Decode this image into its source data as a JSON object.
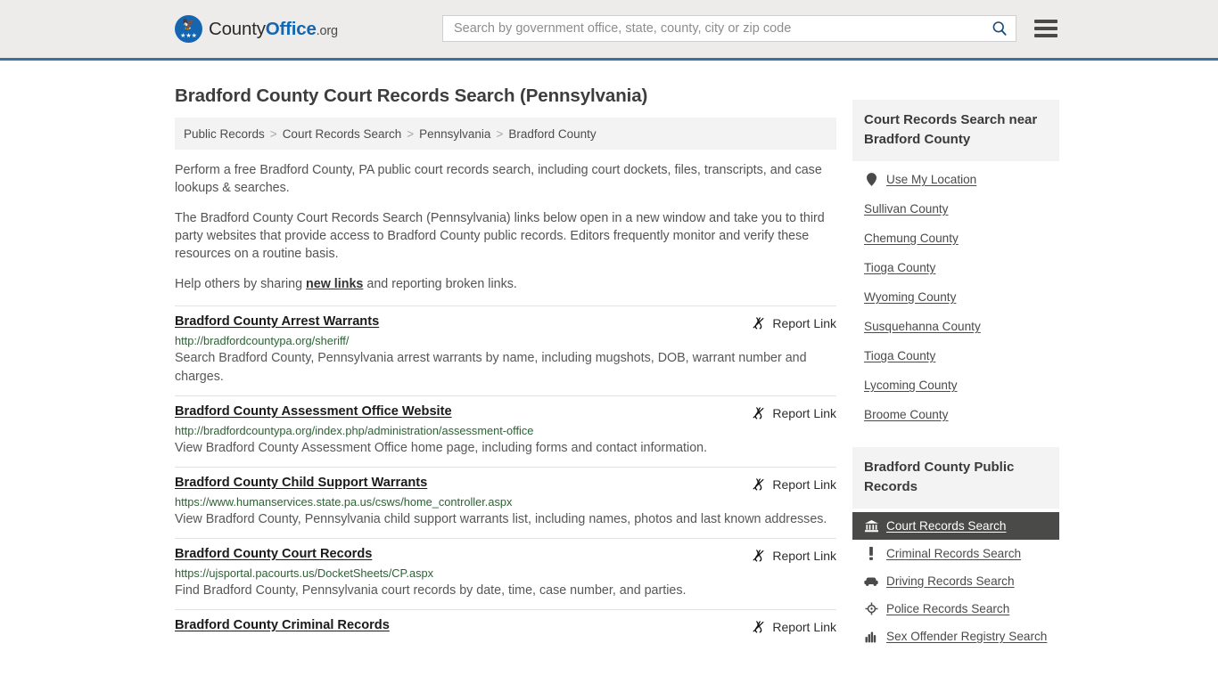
{
  "header": {
    "logo": {
      "part1": "County",
      "part2": "Office",
      "tld": ".org",
      "icon": "eagle-logo-icon"
    },
    "search": {
      "placeholder": "Search by government office, state, county, city or zip code",
      "value": "",
      "icon": "search-icon"
    },
    "menu_icon": "hamburger-menu-icon"
  },
  "page_title": "Bradford County Court Records Search (Pennsylvania)",
  "breadcrumb": {
    "items": [
      "Public Records",
      "Court Records Search",
      "Pennsylvania",
      "Bradford County"
    ],
    "separator": ">"
  },
  "intro": {
    "p1": "Perform a free Bradford County, PA public court records search, including court dockets, files, transcripts, and case lookups & searches.",
    "p2": "The Bradford County Court Records Search (Pennsylvania) links below open in a new window and take you to third party websites that provide access to Bradford County public records. Editors frequently monitor and verify these resources on a routine basis.",
    "p3_before": "Help others by sharing ",
    "p3_link": "new links",
    "p3_after": " and reporting broken links."
  },
  "report_link_label": "Report Link",
  "report_link_icon": "broken-link-icon",
  "results": [
    {
      "title": "Bradford County Arrest Warrants",
      "url": "http://bradfordcountypa.org/sheriff/",
      "desc": "Search Bradford County, Pennsylvania arrest warrants by name, including mugshots, DOB, warrant number and charges."
    },
    {
      "title": "Bradford County Assessment Office Website",
      "url": "http://bradfordcountypa.org/index.php/administration/assessment-office",
      "desc": "View Bradford County Assessment Office home page, including forms and contact information."
    },
    {
      "title": "Bradford County Child Support Warrants",
      "url": "https://www.humanservices.state.pa.us/csws/home_controller.aspx",
      "desc": "View Bradford County, Pennsylvania child support warrants list, including names, photos and last known addresses."
    },
    {
      "title": "Bradford County Court Records",
      "url": "https://ujsportal.pacourts.us/DocketSheets/CP.aspx",
      "desc": "Find Bradford County, Pennsylvania court records by date, time, case number, and parties."
    },
    {
      "title": "Bradford County Criminal Records",
      "url": "",
      "desc": ""
    }
  ],
  "sidebar": {
    "nearby": {
      "heading": "Court Records Search near Bradford County",
      "items": [
        {
          "label": "Use My Location",
          "icon": "map-pin-icon"
        },
        {
          "label": "Sullivan County",
          "icon": ""
        },
        {
          "label": "Chemung County",
          "icon": ""
        },
        {
          "label": "Tioga County",
          "icon": ""
        },
        {
          "label": "Wyoming County",
          "icon": ""
        },
        {
          "label": "Susquehanna County",
          "icon": ""
        },
        {
          "label": "Tioga County",
          "icon": ""
        },
        {
          "label": "Lycoming County",
          "icon": ""
        },
        {
          "label": "Broome County",
          "icon": ""
        }
      ]
    },
    "public_records": {
      "heading": "Bradford County Public Records",
      "items": [
        {
          "label": "Court Records Search",
          "icon": "courthouse-icon",
          "active": true
        },
        {
          "label": "Criminal Records Search",
          "icon": "exclamation-icon",
          "active": false
        },
        {
          "label": "Driving Records Search",
          "icon": "car-icon",
          "active": false
        },
        {
          "label": "Police Records Search",
          "icon": "police-badge-icon",
          "active": false
        },
        {
          "label": "Sex Offender Registry Search",
          "icon": "fingerprint-icon",
          "active": false
        }
      ]
    }
  },
  "colors": {
    "brand_blue": "#1167b3",
    "header_border": "#3b72a4",
    "url_green": "#2a6333",
    "active_bg": "#4a4a48"
  }
}
